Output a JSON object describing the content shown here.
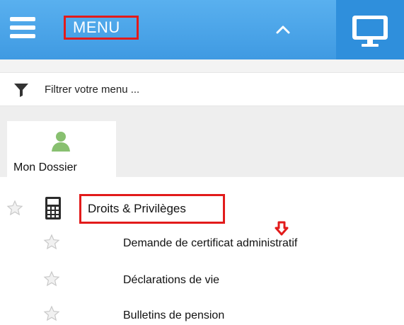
{
  "header": {
    "menu_label": "MENU",
    "icons": {
      "menu": "hamburger-icon",
      "collapse": "chevron-up-icon",
      "display": "monitor-icon"
    },
    "colors": {
      "bar": "#4aa4ea",
      "monitor_box": "#2f8fdc",
      "highlight_border": "#e21b1b"
    }
  },
  "filter": {
    "placeholder": "Filtrer votre menu ...",
    "value": "",
    "icon": "filter-icon"
  },
  "tabs": [
    {
      "label": "Mon Dossier",
      "icon": "person-icon",
      "icon_color": "#88c070"
    }
  ],
  "menu": {
    "section": {
      "label": "Droits & Privilèges",
      "icon": "calculator-icon"
    },
    "items": [
      {
        "label": "Demande de certificat administratif"
      },
      {
        "label": "Déclarations de vie"
      },
      {
        "label": "Bulletins de pension"
      }
    ],
    "marker_icon": "arrow-down-icon",
    "marker_color": "#e21b1b"
  }
}
